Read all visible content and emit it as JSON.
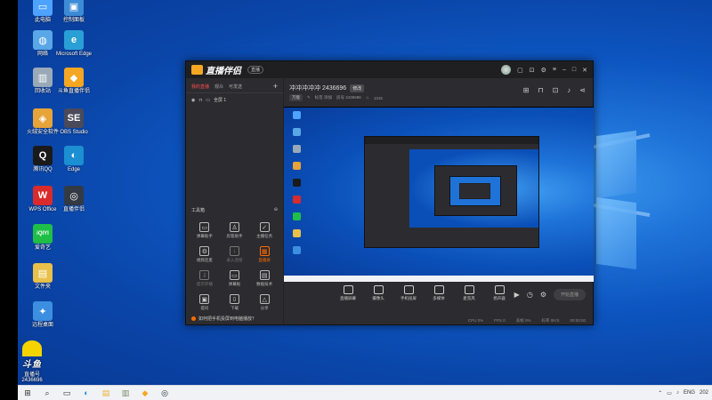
{
  "desktop": {
    "icons": [
      {
        "label": "此电脑",
        "color": "#4da3ff",
        "glyph": "▭"
      },
      {
        "label": "控制面板",
        "color": "#3d8bd6",
        "glyph": "▣"
      },
      {
        "label": "网络",
        "color": "#5aa7e8",
        "glyph": "◍"
      },
      {
        "label": "Microsoft Edge",
        "color": "#2a9fd6",
        "glyph": "e"
      },
      {
        "label": "回收站",
        "color": "#9aa9b8",
        "glyph": "▥"
      },
      {
        "label": "斗鱼直播伴侣",
        "color": "#f5a623",
        "glyph": "◆"
      },
      {
        "label": "火绒安全软件",
        "color": "#e6a43a",
        "glyph": "◈"
      },
      {
        "label": "OBS Studio",
        "color": "#4a4a5a",
        "glyph": "SE"
      },
      {
        "label": "腾讯QQ",
        "color": "#1a1a1a",
        "glyph": "Q"
      },
      {
        "label": "Edge",
        "color": "#1b8fd1",
        "glyph": "◐"
      },
      {
        "label": "WPS Office",
        "color": "#d92b2b",
        "glyph": "W"
      },
      {
        "label": "直播伴侣",
        "color": "#333a44",
        "glyph": "◎"
      },
      {
        "label": "爱奇艺",
        "color": "#1fbf47",
        "glyph": "iQIYI"
      },
      {
        "label": "文件夹",
        "color": "#e8c04a",
        "glyph": "▤"
      },
      {
        "label": "远程桌面",
        "color": "#3c8fe0",
        "glyph": "✦"
      }
    ]
  },
  "taskbar": {
    "tray_lang": "ENG",
    "tray_time": "202"
  },
  "app": {
    "brand": "直播伴侣",
    "badge": "直播",
    "tabs": [
      "我的直播",
      "观众",
      "可发送"
    ],
    "active_tab_index": 0,
    "add_label": "+",
    "scene_name": "全屏 1",
    "toolbox_title": "工具箱",
    "tools": [
      {
        "label": "弹幕助手",
        "glyph": "▭",
        "state": "normal"
      },
      {
        "label": "房管助手",
        "glyph": "♙",
        "state": "normal"
      },
      {
        "label": "主播任务",
        "glyph": "✓",
        "state": "normal"
      },
      {
        "label": "视频连麦",
        "glyph": "⚙",
        "state": "normal"
      },
      {
        "label": "录入连接",
        "glyph": "↓",
        "state": "dim"
      },
      {
        "label": "直播屏",
        "glyph": "▦",
        "state": "hot"
      },
      {
        "label": "提示开播",
        "glyph": "⇩",
        "state": "dim"
      },
      {
        "label": "弹幕板",
        "glyph": "▭",
        "state": "normal"
      },
      {
        "label": "数据技术",
        "glyph": "▤",
        "state": "normal"
      },
      {
        "label": "提问",
        "glyph": "▣",
        "state": "normal"
      },
      {
        "label": "下载",
        "glyph": "⇩",
        "state": "normal"
      },
      {
        "label": "分享",
        "glyph": "△",
        "state": "normal"
      }
    ],
    "notice": "如何把手机投屏到电脑播放？",
    "room": {
      "title": "冲冲冲冲冲 2436696",
      "edit_label": "修改",
      "category_chip": "万能",
      "meta1": "标签 添加",
      "meta2": "房号 2436696",
      "heat": "1315"
    },
    "controls": [
      {
        "label": "直播屏幕"
      },
      {
        "label": "摄像头"
      },
      {
        "label": "手机投屏"
      },
      {
        "label": "多媒体"
      },
      {
        "label": "麦克风"
      },
      {
        "label": "扬声器"
      }
    ],
    "go_live_label": "开始直播",
    "status": [
      "CPU 0%",
      "FPS 0",
      "丢帧 0%",
      "码率 0K/S",
      "00:00:00"
    ]
  },
  "streamer": {
    "logo_text": "斗鱼",
    "sub_text": "直播号",
    "id": "2436696"
  }
}
